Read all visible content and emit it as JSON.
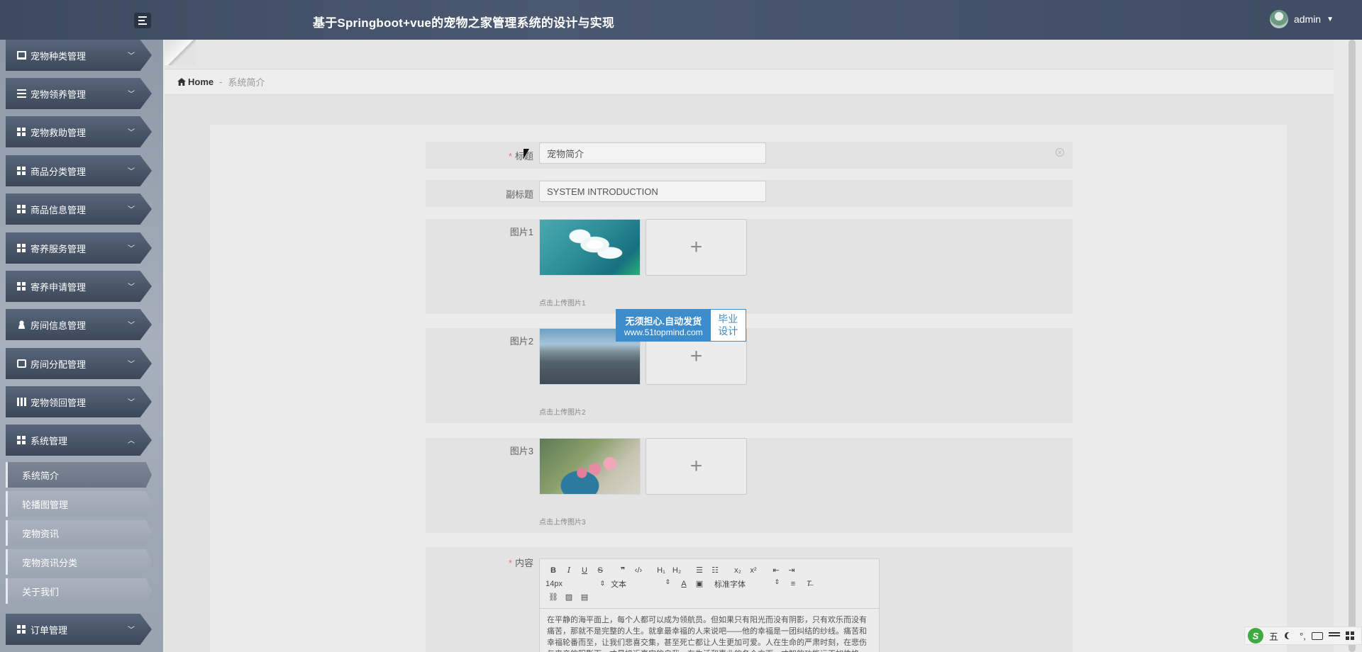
{
  "header": {
    "title": "基于Springboot+vue的宠物之家管理系统的设计与实现",
    "user": "admin"
  },
  "sidebar": {
    "items": [
      {
        "label": "宠物种类管理",
        "icon": "monitor-icon"
      },
      {
        "label": "宠物领养管理",
        "icon": "list-icon"
      },
      {
        "label": "宠物救助管理",
        "icon": "grid-icon"
      },
      {
        "label": "商品分类管理",
        "icon": "grid-icon"
      },
      {
        "label": "商品信息管理",
        "icon": "grid-icon"
      },
      {
        "label": "寄养服务管理",
        "icon": "grid-icon"
      },
      {
        "label": "寄养申请管理",
        "icon": "grid-icon"
      },
      {
        "label": "房间信息管理",
        "icon": "user-icon"
      },
      {
        "label": "房间分配管理",
        "icon": "checkbox-icon"
      },
      {
        "label": "宠物领回管理",
        "icon": "bars-icon"
      },
      {
        "label": "系统管理",
        "icon": "grid-icon"
      }
    ],
    "submenu": [
      "系统简介",
      "轮播图管理",
      "宠物资讯",
      "宠物资讯分类",
      "关于我们"
    ],
    "after": {
      "label": "订单管理",
      "icon": "grid-icon"
    }
  },
  "breadcrumb": {
    "home": "Home",
    "separator": "-",
    "current": "系统简介"
  },
  "form": {
    "title_label": "标题",
    "title_value": "宠物简介",
    "subtitle_label": "副标题",
    "subtitle_value": "SYSTEM INTRODUCTION",
    "images": [
      {
        "label": "图片1",
        "tip": "点击上传图片1"
      },
      {
        "label": "图片2",
        "tip": "点击上传图片2"
      },
      {
        "label": "图片3",
        "tip": "点击上传图片3"
      }
    ],
    "upload_symbol": "+",
    "content_label": "内容",
    "editor": {
      "font_size": "14px",
      "format": "文本",
      "font": "标准字体",
      "text": "在平静的海平面上，每个人都可以成为领航员。但如果只有阳光而没有阴影，只有欢乐而没有痛苦，那就不是完整的人生。就拿最幸福的人来说吧——他的幸福是一团纠结的纱线。痛苦和幸福轮番而至，让我们悲喜交集，甚至死亡都让人生更加可爱。人在生命的严肃时刻，在悲伤与丧亲的阴影下，才最接近真实的自我。在生活和事业的各个方面，才智的功能远不如性格，头脑的功能远不"
    }
  },
  "watermark": {
    "line1": "无须担心.自动发货",
    "line2": "www.51topmind.com",
    "right1": "毕业",
    "right2": "设计"
  },
  "ime": {
    "label": "五",
    "punct": "°,"
  }
}
